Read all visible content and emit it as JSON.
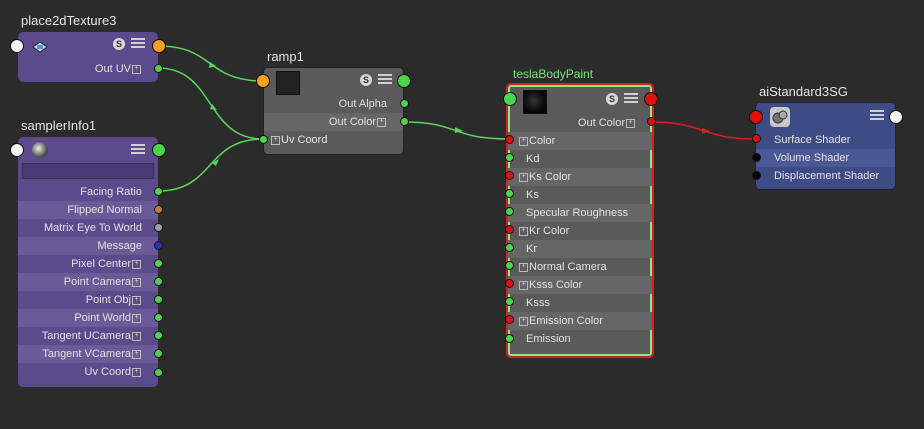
{
  "nodes": {
    "place2d": {
      "title": "place2dTexture3",
      "outputs": [
        "Out UV"
      ]
    },
    "sampler": {
      "title": "samplerInfo1",
      "outputs": [
        "Facing Ratio",
        "Flipped Normal",
        "Matrix Eye To World",
        "Message",
        "Pixel Center",
        "Point Camera",
        "Point Obj",
        "Point World",
        "Tangent UCamera",
        "Tangent VCamera",
        "Uv Coord"
      ]
    },
    "ramp": {
      "title": "ramp1",
      "outputs": [
        "Out Alpha",
        "Out Color"
      ],
      "inputs": [
        "Uv Coord"
      ]
    },
    "tesla": {
      "title": "teslaBodyPaint",
      "outputs": [
        "Out Color"
      ],
      "inputs": [
        "Color",
        "Kd",
        "Ks Color",
        "Ks",
        "Specular Roughness",
        "Kr Color",
        "Kr",
        "Normal Camera",
        "Ksss Color",
        "Ksss",
        "Emission Color",
        "Emission"
      ]
    },
    "sg": {
      "title": "aiStandard3SG",
      "inputs": [
        "Surface Shader",
        "Volume Shader",
        "Displacement Shader"
      ]
    }
  },
  "colors": {
    "wire_green": "#5ad65a",
    "wire_red": "#d42020",
    "texture_node": "#5b4a8c",
    "shader_node": "#5a5a5a",
    "sg_node": "#3e4c86",
    "selected_outline": "#e02020"
  },
  "buttons": {
    "swatch": "S"
  },
  "icons": [
    "place2d-icon",
    "sampler-info-icon",
    "shading-group-icon",
    "swatch-toggle-icon",
    "attribute-menu-icon"
  ]
}
